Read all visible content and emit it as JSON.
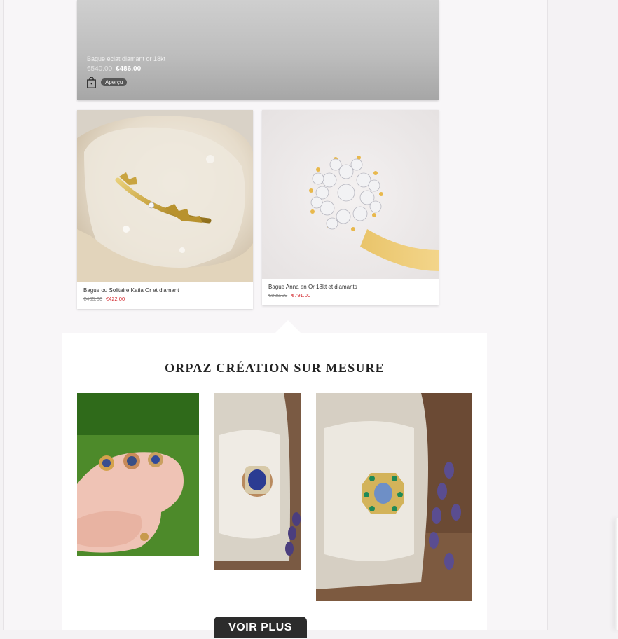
{
  "featured": {
    "name": "Bague éclat diamant or 18kt",
    "old_price": "€540.00",
    "new_price": "€486.00",
    "quickview_label": "Aperçu",
    "bag_icon": "shopping-bag-icon"
  },
  "products": [
    {
      "name": "Bague ou Solitaire Katia Or et diamant",
      "old_price": "€465.00",
      "new_price": "€422.00"
    },
    {
      "name": "Bague Anna en Or 18kt et diamants",
      "old_price": "€880.00",
      "new_price": "€791.00"
    }
  ],
  "custom": {
    "title": "ORPAZ CRÉATION SUR MESURE",
    "more_label": "VOIR PLUS"
  },
  "colors": {
    "sale_price": "#d2262c",
    "button_dark": "#2c2c2c"
  }
}
